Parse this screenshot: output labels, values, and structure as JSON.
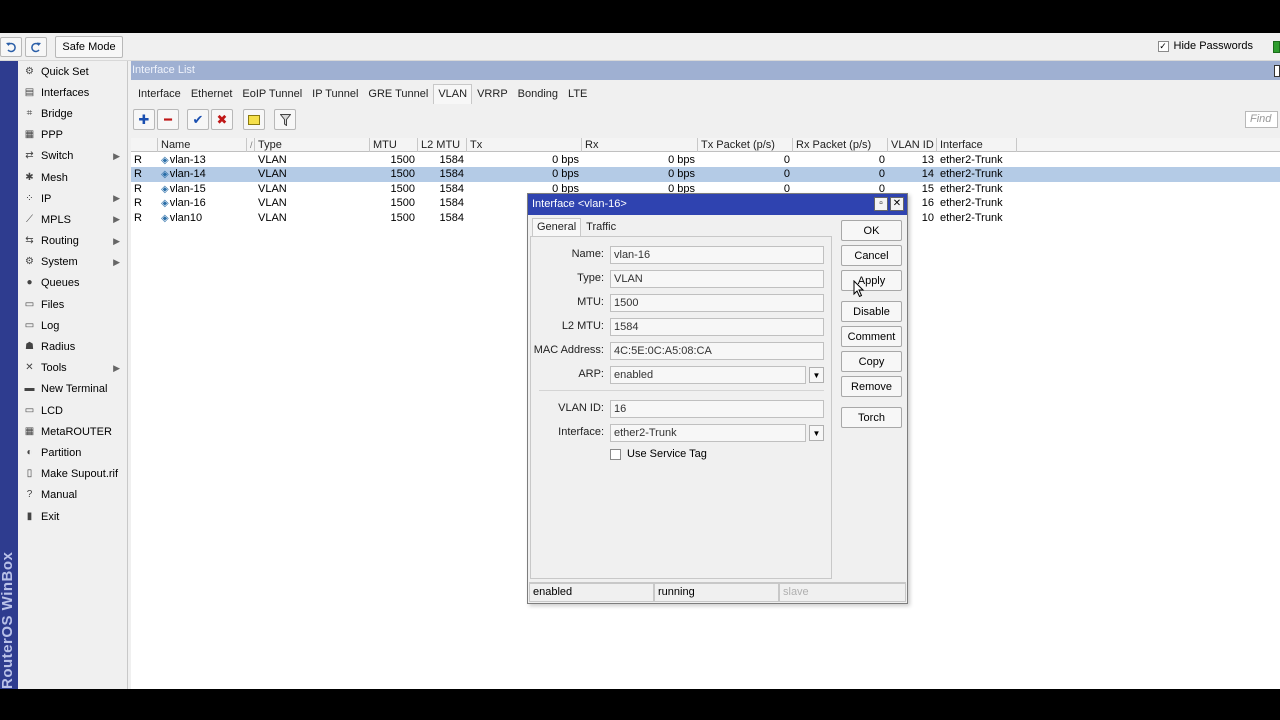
{
  "toolbar": {
    "undo_icon": "undo-icon",
    "redo_icon": "redo-icon",
    "safe_mode_label": "Safe Mode",
    "hide_passwords_label": "Hide Passwords",
    "hide_passwords_checked": "✓",
    "status_color": "#2e9d2e"
  },
  "brand": {
    "text": "RouterOS WinBox"
  },
  "sidebar": {
    "items": [
      {
        "label": "Quick Set",
        "icon": "quick-set-icon",
        "glyph": "⚙"
      },
      {
        "label": "Interfaces",
        "icon": "interfaces-icon",
        "glyph": "▤"
      },
      {
        "label": "Bridge",
        "icon": "bridge-icon",
        "glyph": "⌗"
      },
      {
        "label": "PPP",
        "icon": "ppp-icon",
        "glyph": "▦"
      },
      {
        "label": "Switch",
        "icon": "switch-icon",
        "glyph": "⇄"
      },
      {
        "label": "Mesh",
        "icon": "mesh-icon",
        "glyph": "✱"
      },
      {
        "label": "IP",
        "icon": "ip-icon",
        "glyph": "⁘"
      },
      {
        "label": "MPLS",
        "icon": "mpls-icon",
        "glyph": "⟋"
      },
      {
        "label": "Routing",
        "icon": "routing-icon",
        "glyph": "⇆"
      },
      {
        "label": "System",
        "icon": "system-icon",
        "glyph": "⚙"
      },
      {
        "label": "Queues",
        "icon": "queues-icon",
        "glyph": "●"
      },
      {
        "label": "Files",
        "icon": "files-icon",
        "glyph": "▭"
      },
      {
        "label": "Log",
        "icon": "log-icon",
        "glyph": "▭"
      },
      {
        "label": "Radius",
        "icon": "radius-icon",
        "glyph": "☗"
      },
      {
        "label": "Tools",
        "icon": "tools-icon",
        "glyph": "✕"
      },
      {
        "label": "New Terminal",
        "icon": "terminal-icon",
        "glyph": "▬"
      },
      {
        "label": "LCD",
        "icon": "lcd-icon",
        "glyph": "▭"
      },
      {
        "label": "MetaROUTER",
        "icon": "metarouter-icon",
        "glyph": "▦"
      },
      {
        "label": "Partition",
        "icon": "partition-icon",
        "glyph": "◐"
      },
      {
        "label": "Make Supout.rif",
        "icon": "supout-icon",
        "glyph": "▯"
      },
      {
        "label": "Manual",
        "icon": "manual-icon",
        "glyph": "?"
      },
      {
        "label": "Exit",
        "icon": "exit-icon",
        "glyph": "▮"
      }
    ]
  },
  "window": {
    "title": "Interface List",
    "tabs": [
      "Interface",
      "Ethernet",
      "EoIP Tunnel",
      "IP Tunnel",
      "GRE Tunnel",
      "VLAN",
      "VRRP",
      "Bonding",
      "LTE"
    ],
    "active_tab": "VLAN",
    "find_placeholder": "Find"
  },
  "table": {
    "columns": [
      "",
      "Name",
      "/",
      "Type",
      "MTU",
      "L2 MTU",
      "Tx",
      "Rx",
      "Tx Packet (p/s)",
      "Rx Packet (p/s)",
      "VLAN ID",
      "Interface"
    ],
    "rows": [
      {
        "flag": "R",
        "name": "vlan-13",
        "type": "VLAN",
        "mtu": "1500",
        "l2mtu": "1584",
        "tx": "0 bps",
        "rx": "0 bps",
        "txp": "0",
        "rxp": "0",
        "vlan_id": "13",
        "interface": "ether2-Trunk",
        "selected": false
      },
      {
        "flag": "R",
        "name": "vlan-14",
        "type": "VLAN",
        "mtu": "1500",
        "l2mtu": "1584",
        "tx": "0 bps",
        "rx": "0 bps",
        "txp": "0",
        "rxp": "0",
        "vlan_id": "14",
        "interface": "ether2-Trunk",
        "selected": true
      },
      {
        "flag": "R",
        "name": "vlan-15",
        "type": "VLAN",
        "mtu": "1500",
        "l2mtu": "1584",
        "tx": "0 bps",
        "rx": "0 bps",
        "txp": "0",
        "rxp": "0",
        "vlan_id": "15",
        "interface": "ether2-Trunk",
        "selected": false
      },
      {
        "flag": "R",
        "name": "vlan-16",
        "type": "VLAN",
        "mtu": "1500",
        "l2mtu": "1584",
        "tx": "",
        "rx": "",
        "txp": "",
        "rxp": "",
        "vlan_id": "16",
        "interface": "ether2-Trunk",
        "selected": false
      },
      {
        "flag": "R",
        "name": "vlan10",
        "type": "VLAN",
        "mtu": "1500",
        "l2mtu": "1584",
        "tx": "",
        "rx": "",
        "txp": "",
        "rxp": "",
        "vlan_id": "10",
        "interface": "ether2-Trunk",
        "selected": false
      }
    ]
  },
  "dialog": {
    "title": "Interface <vlan-16>",
    "tabs": [
      "General",
      "Traffic"
    ],
    "active_tab": "General",
    "fields": {
      "name_label": "Name:",
      "name_value": "vlan-16",
      "type_label": "Type:",
      "type_value": "VLAN",
      "mtu_label": "MTU:",
      "mtu_value": "1500",
      "l2mtu_label": "L2 MTU:",
      "l2mtu_value": "1584",
      "mac_label": "MAC Address:",
      "mac_value": "4C:5E:0C:A5:08:CA",
      "arp_label": "ARP:",
      "arp_value": "enabled",
      "vlan_id_label": "VLAN ID:",
      "vlan_id_value": "16",
      "interface_label": "Interface:",
      "interface_value": "ether2-Trunk",
      "service_tag_label": "Use Service Tag"
    },
    "buttons": [
      "OK",
      "Cancel",
      "Apply",
      "Disable",
      "Comment",
      "Copy",
      "Remove",
      "Torch"
    ],
    "status": [
      "enabled",
      "running",
      "slave"
    ]
  }
}
